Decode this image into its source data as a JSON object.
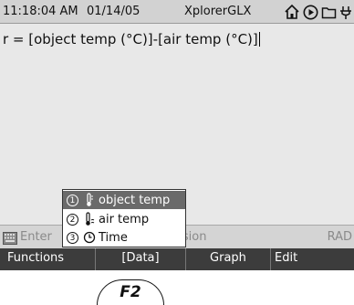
{
  "status": {
    "time": "11:18:04 AM",
    "date": "01/14/05",
    "app_name": "XplorerGLX",
    "icons": [
      "home-icon",
      "play-icon",
      "folder-icon",
      "power-plug-icon"
    ]
  },
  "calculator": {
    "expression": "r = [object temp (°C)]-[air temp (°C)]"
  },
  "input_bar": {
    "hint": "Enter",
    "hint_right": "sion",
    "angle_mode": "RAD"
  },
  "softkeys": {
    "f1": "Functions",
    "f2": "[Data]",
    "f3": "Graph",
    "f4": "Edit"
  },
  "data_menu": {
    "items": [
      {
        "number": "1",
        "label": "object temp",
        "icon": "thermometer-icon",
        "selected": true
      },
      {
        "number": "2",
        "label": "air temp",
        "icon": "thermometer-icon",
        "selected": false
      },
      {
        "number": "3",
        "label": "Time",
        "icon": "clock-icon",
        "selected": false
      }
    ]
  },
  "hardware_key": {
    "label": "F2"
  },
  "colors": {
    "screen_bg": "#e8e8e8",
    "softkey_bar": "#3c3c3c",
    "selected_item": "#6a6a6a"
  }
}
